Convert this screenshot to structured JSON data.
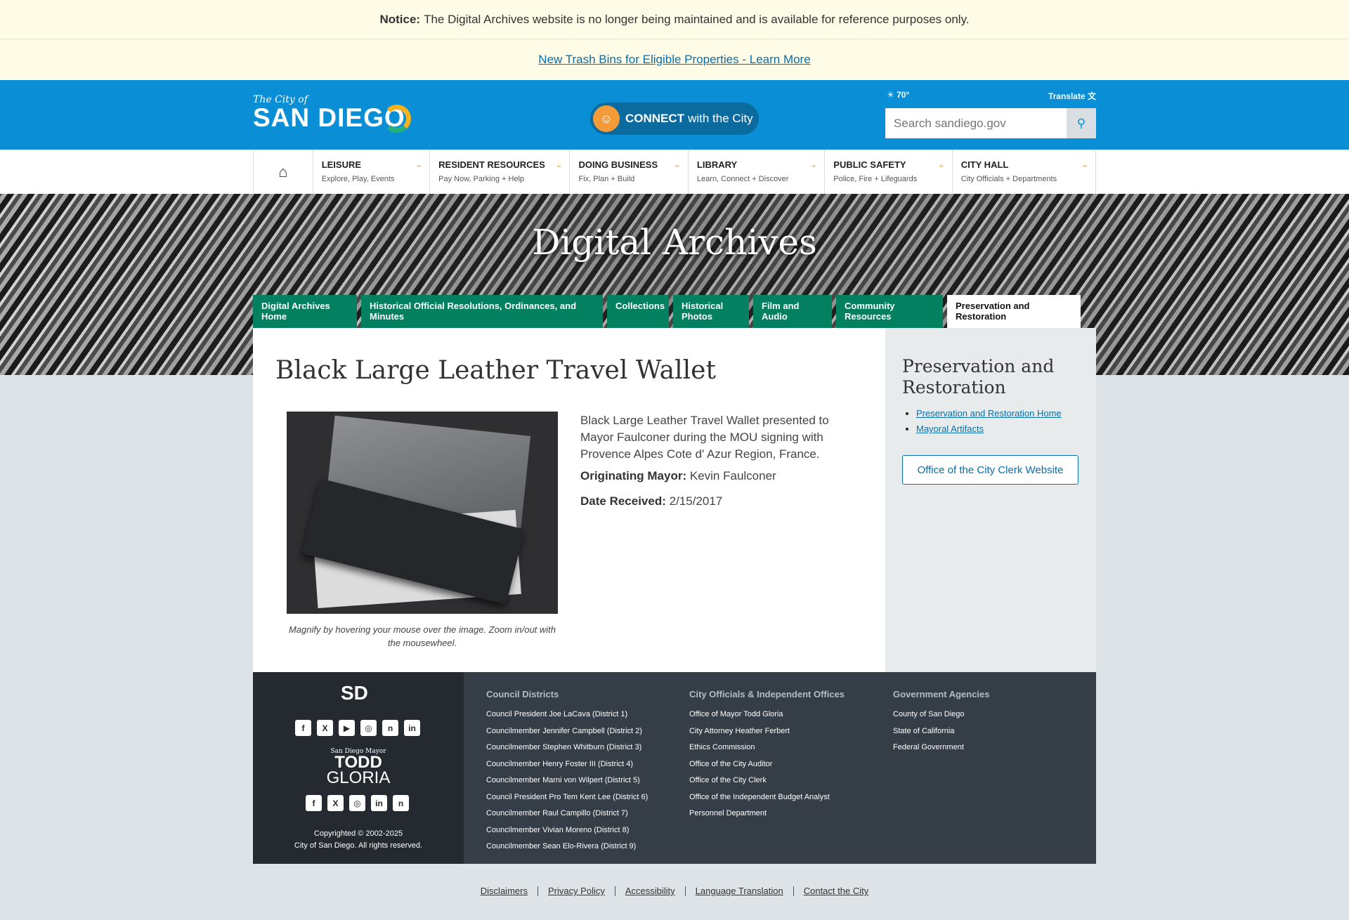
{
  "notice": {
    "label": "Notice:",
    "text": "The Digital Archives website is no longer being maintained and is available for reference purposes only."
  },
  "alert": {
    "link": "New Trash Bins for Eligible Properties - Learn More"
  },
  "header": {
    "logo_small": "The City of",
    "logo_big": "SAN DIEGO",
    "connect_bold": "CONNECT",
    "connect_rest": "with the City",
    "weather": "70°",
    "translate": "Translate",
    "search_placeholder": "Search sandiego.gov"
  },
  "nav": [
    {
      "title": "LEISURE",
      "sub": "Explore, Play, Events"
    },
    {
      "title": "RESIDENT RESOURCES",
      "sub": "Pay Now, Parking + Help"
    },
    {
      "title": "DOING BUSINESS",
      "sub": "Fix, Plan + Build"
    },
    {
      "title": "LIBRARY",
      "sub": "Learn, Connect + Discover"
    },
    {
      "title": "PUBLIC SAFETY",
      "sub": "Police, Fire + Lifeguards"
    },
    {
      "title": "CITY HALL",
      "sub": "City Officials + Departments"
    }
  ],
  "hero": {
    "title": "Digital Archives"
  },
  "tabs": [
    "Digital Archives Home",
    "Historical Official Resolutions, Ordinances, and Minutes",
    "Collections",
    "Historical Photos",
    "Film and Audio",
    "Community Resources",
    "Preservation and Restoration"
  ],
  "item": {
    "title": "Black Large Leather Travel Wallet",
    "caption": "Magnify by hovering your mouse over the image. Zoom in/out with the mousewheel.",
    "description": "Black Large Leather Travel Wallet presented to Mayor Faulconer during the MOU signing with Provence Alpes Cote d' Azur Region, France.",
    "mayor_label": "Originating Mayor:",
    "mayor_value": "Kevin Faulconer",
    "date_label": "Date Received:",
    "date_value": "2/15/2017"
  },
  "sidebar": {
    "title": "Preservation and Restoration",
    "links": [
      "Preservation and Restoration Home",
      "Mayoral Artifacts"
    ],
    "button": "Office of the City Clerk Website"
  },
  "footer": {
    "sd": "SD",
    "mayor_small": "San Diego Mayor",
    "mayor_first": "TODD",
    "mayor_last": "GLORIA",
    "copyright1": "Copyrighted © 2002-2025",
    "copyright2": "City of San Diego. All rights reserved.",
    "council": {
      "heading": "Council Districts",
      "links": [
        "Council President Joe LaCava (District 1)",
        "Councilmember Jennifer Campbell (District 2)",
        "Councilmember Stephen Whitburn (District 3)",
        "Councilmember Henry Foster III (District 4)",
        "Councilmember Marni von Wilpert (District 5)",
        "Council President Pro Tem Kent Lee (District 6)",
        "Councilmember Raul Campillo (District 7)",
        "Councilmember Vivian Moreno (District 8)",
        "Councilmember Sean Elo-Rivera (District 9)"
      ]
    },
    "officials": {
      "heading": "City Officials & Independent Offices",
      "links": [
        "Office of Mayor Todd Gloria",
        "City Attorney Heather Ferbert",
        "Ethics Commission",
        "Office of the City Auditor",
        "Office of the City Clerk",
        "Office of the Independent Budget Analyst",
        "Personnel Department"
      ]
    },
    "agencies": {
      "heading": "Government Agencies",
      "links": [
        "County of San Diego",
        "State of California",
        "Federal Government"
      ]
    }
  },
  "legal": [
    "Disclaimers",
    "Privacy Policy",
    "Accessibility",
    "Language Translation",
    "Contact the City"
  ],
  "colors": {
    "brand_blue": "#0a8fd6",
    "tab_green": "#03805f",
    "accent_orange": "#f29b38"
  }
}
